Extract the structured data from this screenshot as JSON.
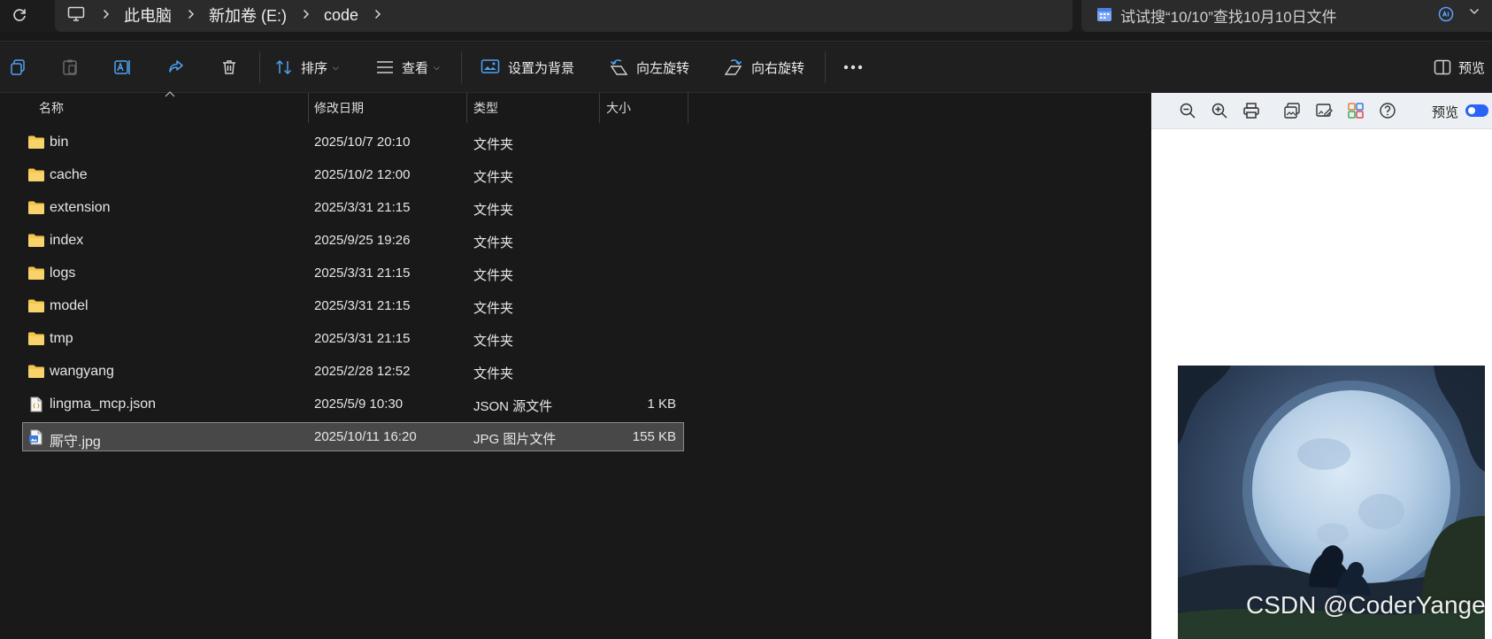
{
  "address_bar": {
    "breadcrumbs": [
      "此电脑",
      "新加卷 (E:)",
      "code"
    ],
    "search_placeholder": "试试搜“10/10”查找10月10日文件"
  },
  "command_bar": {
    "sort_label": "排序",
    "view_label": "查看",
    "set_background_label": "设置为背景",
    "rotate_left_label": "向左旋转",
    "rotate_right_label": "向右旋转",
    "preview_label": "预览"
  },
  "columns": {
    "name": "名称",
    "date_modified": "修改日期",
    "type": "类型",
    "size": "大小"
  },
  "files": [
    {
      "name": "bin",
      "date": "2025/10/7 20:10",
      "type": "文件夹",
      "size": "",
      "icon": "folder-icon"
    },
    {
      "name": "cache",
      "date": "2025/10/2 12:00",
      "type": "文件夹",
      "size": "",
      "icon": "folder-icon"
    },
    {
      "name": "extension",
      "date": "2025/3/31 21:15",
      "type": "文件夹",
      "size": "",
      "icon": "folder-icon"
    },
    {
      "name": "index",
      "date": "2025/9/25 19:26",
      "type": "文件夹",
      "size": "",
      "icon": "folder-icon"
    },
    {
      "name": "logs",
      "date": "2025/3/31 21:15",
      "type": "文件夹",
      "size": "",
      "icon": "folder-icon"
    },
    {
      "name": "model",
      "date": "2025/3/31 21:15",
      "type": "文件夹",
      "size": "",
      "icon": "folder-icon"
    },
    {
      "name": "tmp",
      "date": "2025/3/31 21:15",
      "type": "文件夹",
      "size": "",
      "icon": "folder-icon"
    },
    {
      "name": "wangyang",
      "date": "2025/2/28 12:52",
      "type": "文件夹",
      "size": "",
      "icon": "folder-icon"
    },
    {
      "name": "lingma_mcp.json",
      "date": "2025/5/9 10:30",
      "type": "JSON 源文件",
      "size": "1 KB",
      "icon": "json-file-icon"
    },
    {
      "name": "厮守.jpg",
      "date": "2025/10/11 16:20",
      "type": "JPG 图片文件",
      "size": "155 KB",
      "icon": "image-file-icon",
      "selected": true
    }
  ],
  "preview_pane": {
    "toggle_label": "预览",
    "toggle_on": true,
    "watermark": "CSDN @CoderYanger"
  },
  "colors": {
    "background": "#191919",
    "selection": "#484848",
    "folder": "#f4c64e",
    "accent": "#2a64f6"
  }
}
